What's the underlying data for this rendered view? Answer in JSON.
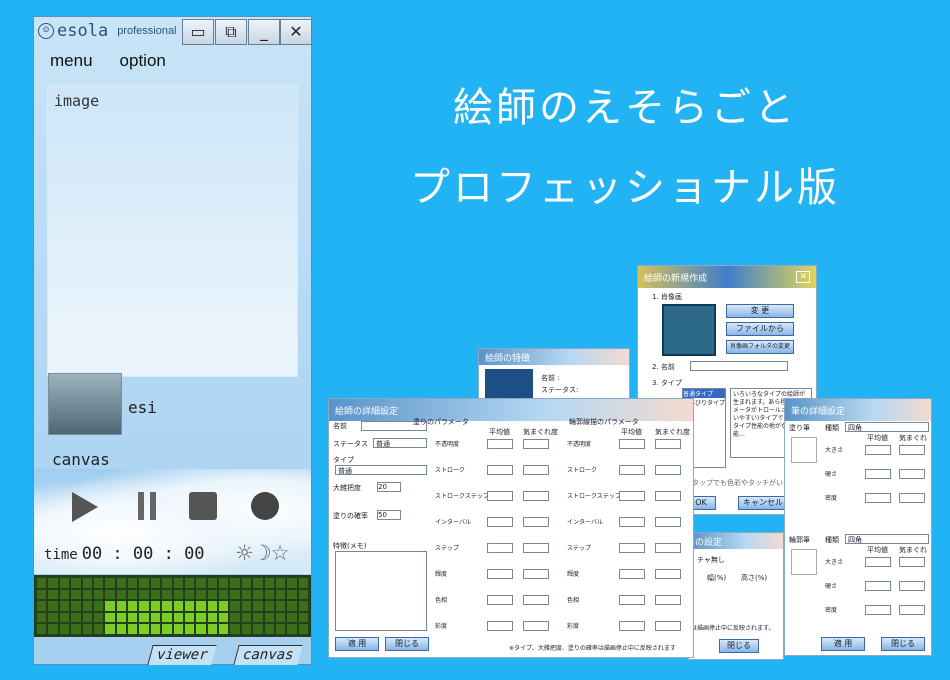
{
  "app": {
    "logo_text": "esola",
    "edition": "professional",
    "window_buttons": [
      "restore-icon",
      "copy-icon",
      "minimize-icon",
      "close-icon"
    ],
    "menu": [
      "menu",
      "option"
    ],
    "image_label": "image",
    "esi_label": "esi",
    "canvas_label": "canvas",
    "controls": [
      "play-icon",
      "pause-icon",
      "stop-icon",
      "record-icon"
    ],
    "time_label": "time",
    "time_value": "00 : 00 : 00",
    "mode_icons": "☼☽☆",
    "tabs": [
      "viewer",
      "canvas"
    ]
  },
  "hero": {
    "line1": "絵師のえそらごと",
    "line2": "プロフェッショナル版"
  },
  "win_new": {
    "title": "絵師の新規作成",
    "sec1": "1. 肖像画",
    "change": "変 更",
    "from_file": "ファイルから",
    "folder": "肖像画フォルダの変更",
    "sec2": "2. 名前",
    "sec3": "3. タイプ",
    "type_items": [
      "普通タイプ",
      "のんびりタイプ"
    ],
    "desc": "いろいろなタイプの絵師が生まれます。あら程度パラメータがトロールされた(使いやすい)タイプです。普通タイプ性能の他がなく性能…",
    "cancel": "キャンセル",
    "ok": "OK",
    "note": "タップでも色彩やタッチがいろいろ"
  },
  "win_feature": {
    "title": "絵師の特徴",
    "name": "名前 :",
    "status": "ステータス:"
  },
  "win_detail": {
    "title": "絵師の詳細設定",
    "labels": [
      "名前",
      "ステータス",
      "タイプ",
      "大雑把度",
      "塗りの確率",
      "特徴(メモ)"
    ],
    "status_val": "普通",
    "type_val": "普通",
    "val20": "20",
    "val50": "50",
    "apply": "適 用",
    "close": "閉じる",
    "paint_title": "塗りのパラメータ",
    "line_title": "輪郭線描のパラメータ",
    "col_avg": "平均値",
    "col_var": "気まぐれ度",
    "params": [
      "不透明度",
      "ストローク",
      "ストロークステップ",
      "インターバル",
      "ステップ",
      "輝度",
      "色相",
      "彩度"
    ],
    "note": "※タイプ、大雑把度、塗りの確率は描画停止中に反映されます"
  },
  "win_brush": {
    "title": "筆の詳細設定",
    "brush1": "塗り筆",
    "brush2": "輪郭筆",
    "kind": "種類",
    "kind_val": "四角",
    "avg": "平均値",
    "var": "気まぐれ度",
    "params": [
      "大きさ",
      "硬さ",
      "密度"
    ],
    "apply": "適 用",
    "close": "閉じる"
  },
  "win_misc": {
    "title": "の設定",
    "labels": [
      "チャ無し",
      "幅(%)",
      "高さ(%)"
    ],
    "note": "は描画停止中に反映されます。",
    "close": "閉じる"
  }
}
